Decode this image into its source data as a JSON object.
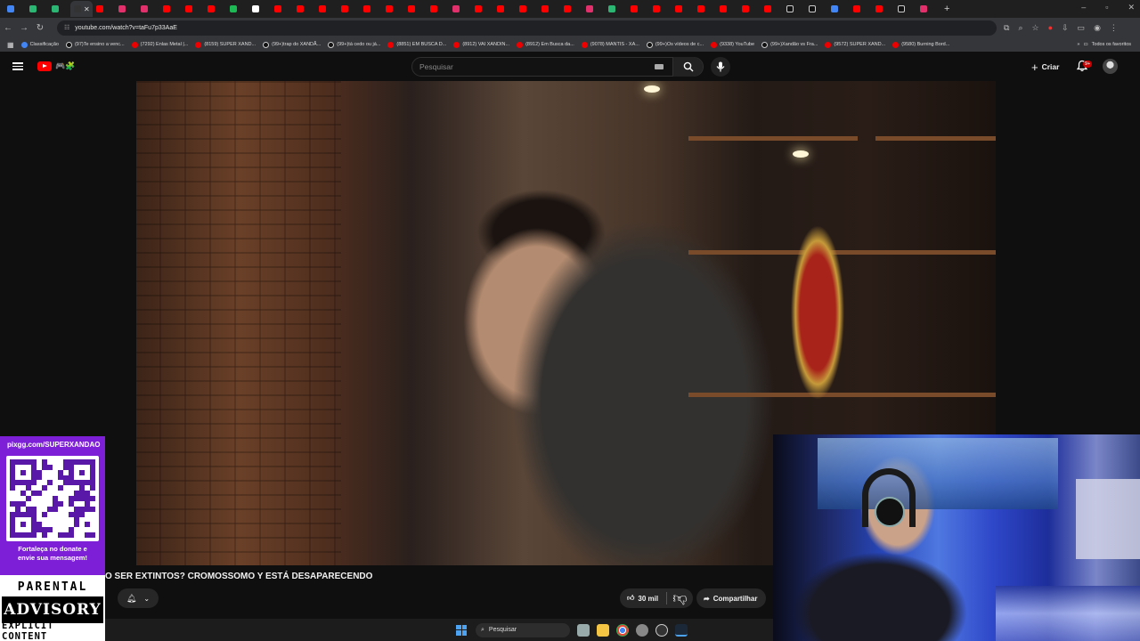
{
  "browser": {
    "url": "youtube.com/watch?v=taFu7p33AaE",
    "bookmarks": [
      "Classificação",
      "(97)Te ensino a venc...",
      "(7292) Enlas Metal |...",
      "(8159) SUPER XAND...",
      "(99+)trap do XANDÃ...",
      "(99+)tá cedo ou já...",
      "(8851) EM BUSCA D...",
      "(8912) VAI XANDIN...",
      "(8912) Em Busca da...",
      "(9078) MANTIS - XA...",
      "(99+)Os vídeos de c...",
      "(9338) YouTube",
      "(99+)Xandão vs Fra...",
      "(9572) SUPER XAND...",
      "(9580) Burning Bord..."
    ],
    "all_bookmarks_label": "Todos os favoritos"
  },
  "youtube": {
    "search_placeholder": "Pesquisar",
    "create_label": "Criar",
    "notifications_badge": "9+",
    "video_title": "O SER EXTINTOS? CROMOSSOMO Y ESTÁ DESAPARECENDO",
    "like_count": "30 mil",
    "share_label": "Compartilhar"
  },
  "overlay": {
    "pix_url": "pixgg.com/SUPERXANDAO",
    "pix_caption_line1": "Fortaleça no donate e",
    "pix_caption_line2": "envie sua mensagem!",
    "advisory_top": "PARENTAL",
    "advisory_mid": "ADVISORY",
    "advisory_bottom": "EXPLICIT CONTENT"
  },
  "taskbar": {
    "search_label": "Pesquisar"
  },
  "colors": {
    "youtube_red": "#ff0000",
    "pix_purple": "#7c1fd6",
    "page_bg": "#0f0f0f"
  }
}
